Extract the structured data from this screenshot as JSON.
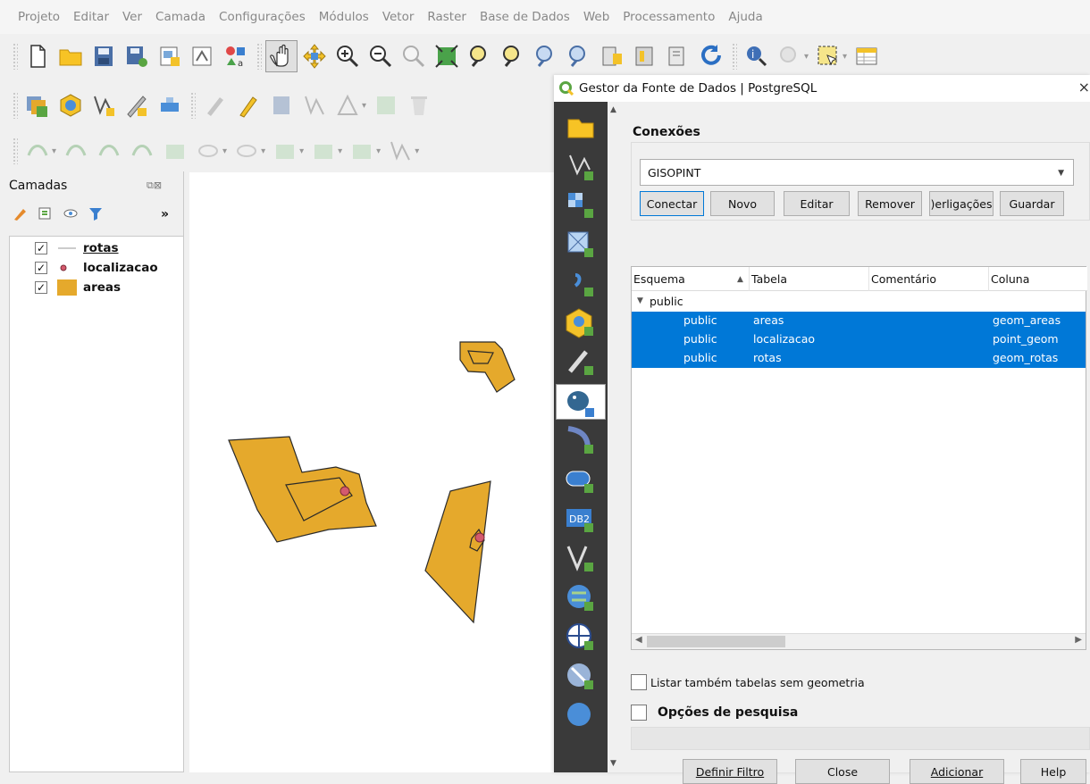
{
  "menubar": [
    "Projeto",
    "Editar",
    "Ver",
    "Camada",
    "Configurações",
    "Módulos",
    "Vetor",
    "Raster",
    "Base de Dados",
    "Web",
    "Processamento",
    "Ajuda"
  ],
  "layers_panel": {
    "title": "Camadas",
    "more": "»",
    "items": [
      {
        "name": "rotas",
        "checked": "✓",
        "symbol": "line"
      },
      {
        "name": "localizacao",
        "checked": "✓",
        "symbol": "point"
      },
      {
        "name": "areas",
        "checked": "✓",
        "symbol": "polygon"
      }
    ]
  },
  "colors": {
    "polygon_fill": "#e5a92c",
    "polygon_stroke": "#333333",
    "point_fill": "#d45a6e",
    "selection": "#0078d7",
    "dialog_sidebar": "#3a3a3a"
  },
  "dialog": {
    "title": "Gestor da Fonte de Dados | PostgreSQL",
    "close": "×",
    "sidebar_icons": [
      "browser-icon",
      "vector-icon",
      "raster-icon",
      "mesh-icon",
      "delimited-text-icon",
      "geopackage-icon",
      "spatialite-icon",
      "postgresql-icon",
      "mssql-icon",
      "oracle-icon",
      "db2-icon",
      "virtual-layer-icon",
      "wms-icon",
      "wfs-icon",
      "wcs-icon",
      "xyz-icon"
    ],
    "connections_label": "Conexões",
    "connection_selected": "GISOPINT",
    "buttons": {
      "connect": "Conectar",
      "new": "Novo",
      "edit": "Editar",
      "remove": "Remover",
      "links": ")erligações",
      "save": "Guardar"
    },
    "table": {
      "columns": [
        "Esquema",
        "Tabela",
        "Comentário",
        "Coluna"
      ],
      "sort_indicator": "▲",
      "group": "public",
      "group_toggle": "▼",
      "rows": [
        {
          "schema": "public",
          "table": "areas",
          "comment": "",
          "column": "geom_areas"
        },
        {
          "schema": "public",
          "table": "localizacao",
          "comment": "",
          "column": "point_geom"
        },
        {
          "schema": "public",
          "table": "rotas",
          "comment": "",
          "column": "geom_rotas"
        }
      ]
    },
    "list_no_geometry": "Listar também tabelas sem geometria",
    "search_options": "Opções de pesquisa",
    "footer": {
      "filter": "Definir Filtro",
      "close": "Close",
      "add": "Adicionar",
      "help": "Help"
    }
  }
}
